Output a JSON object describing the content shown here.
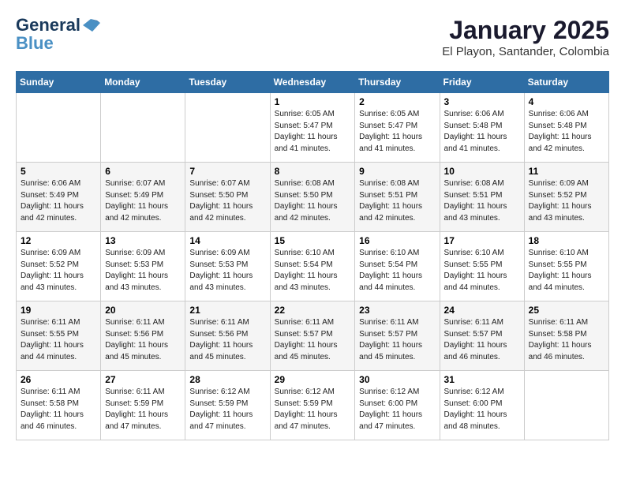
{
  "logo": {
    "line1": "General",
    "line2": "Blue"
  },
  "title": "January 2025",
  "location": "El Playon, Santander, Colombia",
  "days_header": [
    "Sunday",
    "Monday",
    "Tuesday",
    "Wednesday",
    "Thursday",
    "Friday",
    "Saturday"
  ],
  "weeks": [
    [
      {
        "num": "",
        "info": ""
      },
      {
        "num": "",
        "info": ""
      },
      {
        "num": "",
        "info": ""
      },
      {
        "num": "1",
        "info": "Sunrise: 6:05 AM\nSunset: 5:47 PM\nDaylight: 11 hours and 41 minutes."
      },
      {
        "num": "2",
        "info": "Sunrise: 6:05 AM\nSunset: 5:47 PM\nDaylight: 11 hours and 41 minutes."
      },
      {
        "num": "3",
        "info": "Sunrise: 6:06 AM\nSunset: 5:48 PM\nDaylight: 11 hours and 41 minutes."
      },
      {
        "num": "4",
        "info": "Sunrise: 6:06 AM\nSunset: 5:48 PM\nDaylight: 11 hours and 42 minutes."
      }
    ],
    [
      {
        "num": "5",
        "info": "Sunrise: 6:06 AM\nSunset: 5:49 PM\nDaylight: 11 hours and 42 minutes."
      },
      {
        "num": "6",
        "info": "Sunrise: 6:07 AM\nSunset: 5:49 PM\nDaylight: 11 hours and 42 minutes."
      },
      {
        "num": "7",
        "info": "Sunrise: 6:07 AM\nSunset: 5:50 PM\nDaylight: 11 hours and 42 minutes."
      },
      {
        "num": "8",
        "info": "Sunrise: 6:08 AM\nSunset: 5:50 PM\nDaylight: 11 hours and 42 minutes."
      },
      {
        "num": "9",
        "info": "Sunrise: 6:08 AM\nSunset: 5:51 PM\nDaylight: 11 hours and 42 minutes."
      },
      {
        "num": "10",
        "info": "Sunrise: 6:08 AM\nSunset: 5:51 PM\nDaylight: 11 hours and 43 minutes."
      },
      {
        "num": "11",
        "info": "Sunrise: 6:09 AM\nSunset: 5:52 PM\nDaylight: 11 hours and 43 minutes."
      }
    ],
    [
      {
        "num": "12",
        "info": "Sunrise: 6:09 AM\nSunset: 5:52 PM\nDaylight: 11 hours and 43 minutes."
      },
      {
        "num": "13",
        "info": "Sunrise: 6:09 AM\nSunset: 5:53 PM\nDaylight: 11 hours and 43 minutes."
      },
      {
        "num": "14",
        "info": "Sunrise: 6:09 AM\nSunset: 5:53 PM\nDaylight: 11 hours and 43 minutes."
      },
      {
        "num": "15",
        "info": "Sunrise: 6:10 AM\nSunset: 5:54 PM\nDaylight: 11 hours and 43 minutes."
      },
      {
        "num": "16",
        "info": "Sunrise: 6:10 AM\nSunset: 5:54 PM\nDaylight: 11 hours and 44 minutes."
      },
      {
        "num": "17",
        "info": "Sunrise: 6:10 AM\nSunset: 5:55 PM\nDaylight: 11 hours and 44 minutes."
      },
      {
        "num": "18",
        "info": "Sunrise: 6:10 AM\nSunset: 5:55 PM\nDaylight: 11 hours and 44 minutes."
      }
    ],
    [
      {
        "num": "19",
        "info": "Sunrise: 6:11 AM\nSunset: 5:55 PM\nDaylight: 11 hours and 44 minutes."
      },
      {
        "num": "20",
        "info": "Sunrise: 6:11 AM\nSunset: 5:56 PM\nDaylight: 11 hours and 45 minutes."
      },
      {
        "num": "21",
        "info": "Sunrise: 6:11 AM\nSunset: 5:56 PM\nDaylight: 11 hours and 45 minutes."
      },
      {
        "num": "22",
        "info": "Sunrise: 6:11 AM\nSunset: 5:57 PM\nDaylight: 11 hours and 45 minutes."
      },
      {
        "num": "23",
        "info": "Sunrise: 6:11 AM\nSunset: 5:57 PM\nDaylight: 11 hours and 45 minutes."
      },
      {
        "num": "24",
        "info": "Sunrise: 6:11 AM\nSunset: 5:57 PM\nDaylight: 11 hours and 46 minutes."
      },
      {
        "num": "25",
        "info": "Sunrise: 6:11 AM\nSunset: 5:58 PM\nDaylight: 11 hours and 46 minutes."
      }
    ],
    [
      {
        "num": "26",
        "info": "Sunrise: 6:11 AM\nSunset: 5:58 PM\nDaylight: 11 hours and 46 minutes."
      },
      {
        "num": "27",
        "info": "Sunrise: 6:11 AM\nSunset: 5:59 PM\nDaylight: 11 hours and 47 minutes."
      },
      {
        "num": "28",
        "info": "Sunrise: 6:12 AM\nSunset: 5:59 PM\nDaylight: 11 hours and 47 minutes."
      },
      {
        "num": "29",
        "info": "Sunrise: 6:12 AM\nSunset: 5:59 PM\nDaylight: 11 hours and 47 minutes."
      },
      {
        "num": "30",
        "info": "Sunrise: 6:12 AM\nSunset: 6:00 PM\nDaylight: 11 hours and 47 minutes."
      },
      {
        "num": "31",
        "info": "Sunrise: 6:12 AM\nSunset: 6:00 PM\nDaylight: 11 hours and 48 minutes."
      },
      {
        "num": "",
        "info": ""
      }
    ]
  ]
}
